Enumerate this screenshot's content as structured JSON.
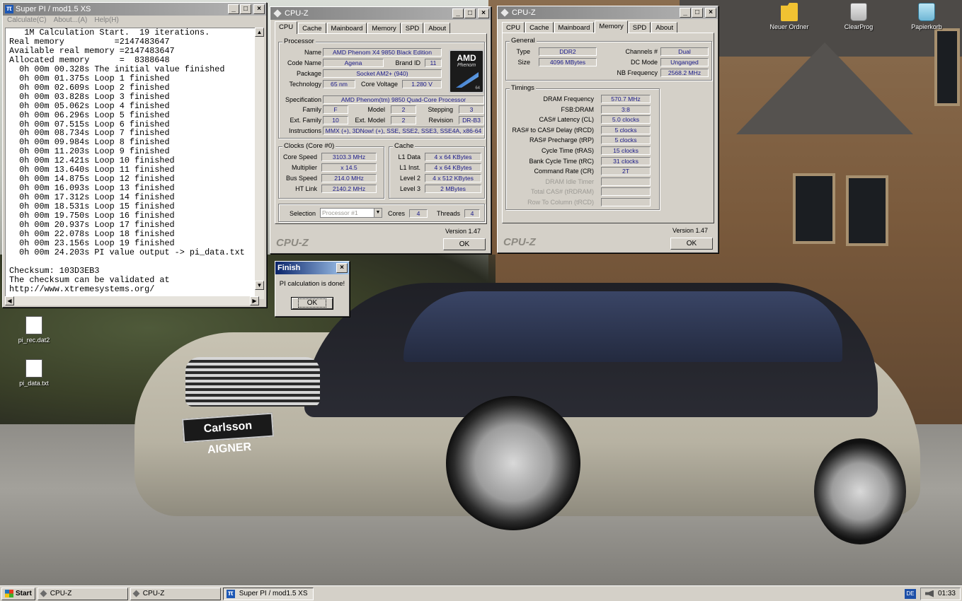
{
  "desktop": {
    "icons": [
      {
        "label": "Neuer Ordner"
      },
      {
        "label": "ClearProg"
      },
      {
        "label": "Papierkorb"
      },
      {
        "label": "pi_rec.dat2"
      },
      {
        "label": "pi_data.txt"
      }
    ],
    "wallpaper_plate": "Carlsson AIGNER"
  },
  "superpi": {
    "title": "Super PI / mod1.5 XS",
    "menu": [
      "Calculate(C)",
      "About...(A)",
      "Help(H)"
    ],
    "lines": [
      "   1M Calculation Start.  19 iterations.",
      "Real memory          =2147483647",
      "Available real memory =2147483647",
      "Allocated memory      =  8388648",
      "  0h 00m 00.328s The initial value finished",
      "  0h 00m 01.375s Loop 1 finished",
      "  0h 00m 02.609s Loop 2 finished",
      "  0h 00m 03.828s Loop 3 finished",
      "  0h 00m 05.062s Loop 4 finished",
      "  0h 00m 06.296s Loop 5 finished",
      "  0h 00m 07.515s Loop 6 finished",
      "  0h 00m 08.734s Loop 7 finished",
      "  0h 00m 09.984s Loop 8 finished",
      "  0h 00m 11.203s Loop 9 finished",
      "  0h 00m 12.421s Loop 10 finished",
      "  0h 00m 13.640s Loop 11 finished",
      "  0h 00m 14.875s Loop 12 finished",
      "  0h 00m 16.093s Loop 13 finished",
      "  0h 00m 17.312s Loop 14 finished",
      "  0h 00m 18.531s Loop 15 finished",
      "  0h 00m 19.750s Loop 16 finished",
      "  0h 00m 20.937s Loop 17 finished",
      "  0h 00m 22.078s Loop 18 finished",
      "  0h 00m 23.156s Loop 19 finished",
      "  0h 00m 24.203s PI value output -> pi_data.txt",
      "",
      "Checksum: 103D3EB3",
      "The checksum can be validated at",
      "http://www.xtremesystems.org/"
    ]
  },
  "cpuz_cpu": {
    "title": "CPU-Z",
    "tabs": [
      "CPU",
      "Cache",
      "Mainboard",
      "Memory",
      "SPD",
      "About"
    ],
    "processor": {
      "group": "Processor",
      "name_label": "Name",
      "name": "AMD Phenom X4 9850 Black Edition",
      "codename_label": "Code Name",
      "codename": "Agena",
      "brandid_label": "Brand ID",
      "brandid": "11",
      "package_label": "Package",
      "package": "Socket AM2+ (940)",
      "technology_label": "Technology",
      "technology": "65 nm",
      "voltage_label": "Core Voltage",
      "voltage": "1.280 V",
      "spec_label": "Specification",
      "spec": "AMD Phenom(tm) 9850 Quad-Core Processor",
      "family_label": "Family",
      "family": "F",
      "model_label": "Model",
      "model": "2",
      "stepping_label": "Stepping",
      "stepping": "3",
      "extfamily_label": "Ext. Family",
      "extfamily": "10",
      "extmodel_label": "Ext. Model",
      "extmodel": "2",
      "revision_label": "Revision",
      "revision": "DR-B3",
      "instr_label": "Instructions",
      "instr": "MMX (+), 3DNow! (+), SSE, SSE2, SSE3, SSE4A, x86-64",
      "logo_brand": "AMD",
      "logo_line": "Phenom",
      "logo_badge": "64"
    },
    "clocks": {
      "group": "Clocks (Core #0)",
      "corespeed_label": "Core Speed",
      "corespeed": "3103.3 MHz",
      "multiplier_label": "Multiplier",
      "multiplier": "x 14.5",
      "busspeed_label": "Bus Speed",
      "busspeed": "214.0 MHz",
      "htlink_label": "HT Link",
      "htlink": "2140.2 MHz"
    },
    "cache": {
      "group": "Cache",
      "l1d_label": "L1 Data",
      "l1d": "4 x 64 KBytes",
      "l1i_label": "L1 Inst.",
      "l1i": "4 x 64 KBytes",
      "l2_label": "Level 2",
      "l2": "4 x 512 KBytes",
      "l3_label": "Level 3",
      "l3": "2 MBytes"
    },
    "selection_label": "Selection",
    "selection": "Processor #1",
    "cores_label": "Cores",
    "cores": "4",
    "threads_label": "Threads",
    "threads": "4",
    "version": "Version 1.47",
    "brand": "CPU-Z",
    "ok": "OK"
  },
  "cpuz_mem": {
    "title": "CPU-Z",
    "tabs": [
      "CPU",
      "Cache",
      "Mainboard",
      "Memory",
      "SPD",
      "About"
    ],
    "general": {
      "group": "General",
      "type_label": "Type",
      "type": "DDR2",
      "size_label": "Size",
      "size": "4096 MBytes",
      "channels_label": "Channels #",
      "channels": "Dual",
      "dcmode_label": "DC Mode",
      "dcmode": "Unganged",
      "nbfreq_label": "NB Frequency",
      "nbfreq": "2568.2 MHz"
    },
    "timings": {
      "group": "Timings",
      "rows": [
        {
          "label": "DRAM Frequency",
          "value": "570.7 MHz",
          "dim": false
        },
        {
          "label": "FSB:DRAM",
          "value": "3:8",
          "dim": false
        },
        {
          "label": "CAS# Latency (CL)",
          "value": "5.0 clocks",
          "dim": false
        },
        {
          "label": "RAS# to CAS# Delay (tRCD)",
          "value": "5 clocks",
          "dim": false
        },
        {
          "label": "RAS# Precharge (tRP)",
          "value": "5 clocks",
          "dim": false
        },
        {
          "label": "Cycle Time (tRAS)",
          "value": "15 clocks",
          "dim": false
        },
        {
          "label": "Bank Cycle Time (tRC)",
          "value": "31 clocks",
          "dim": false
        },
        {
          "label": "Command Rate (CR)",
          "value": "2T",
          "dim": false
        },
        {
          "label": "DRAM Idle Timer",
          "value": "",
          "dim": true
        },
        {
          "label": "Total CAS# (tRDRAM)",
          "value": "",
          "dim": true
        },
        {
          "label": "Row To Column (tRCD)",
          "value": "",
          "dim": true
        }
      ]
    },
    "version": "Version 1.47",
    "brand": "CPU-Z",
    "ok": "OK"
  },
  "finish": {
    "title": "Finish",
    "message": "PI calculation is done!",
    "ok": "OK"
  },
  "taskbar": {
    "start": "Start",
    "buttons": [
      "CPU-Z",
      "CPU-Z",
      "Super PI / mod1.5 XS"
    ],
    "lang": "DE",
    "clock": "01:33"
  }
}
